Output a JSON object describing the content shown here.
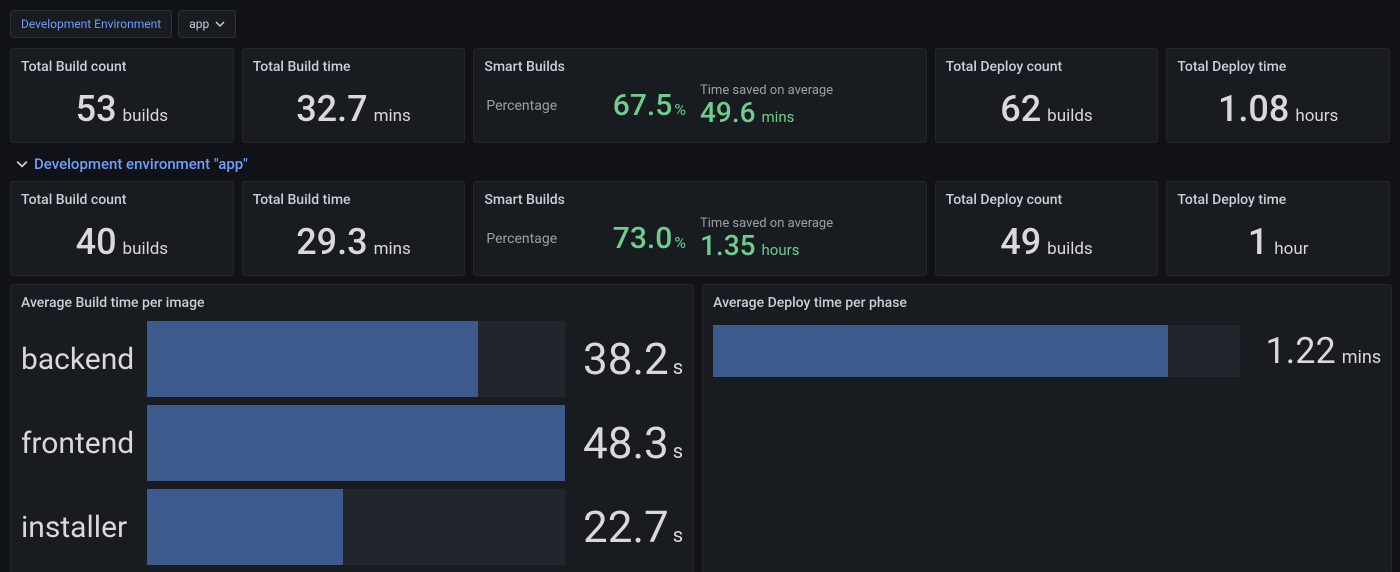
{
  "header": {
    "env_label": "Development Environment",
    "dropdown_value": "app"
  },
  "row1": {
    "build_count": {
      "title": "Total Build count",
      "value": "53",
      "unit": "builds"
    },
    "build_time": {
      "title": "Total Build time",
      "value": "32.7",
      "unit": "mins"
    },
    "smart": {
      "title": "Smart Builds",
      "pct_label": "Percentage",
      "pct_value": "67.5",
      "pct_unit": "%",
      "saved_label": "Time saved on average",
      "saved_value": "49.6",
      "saved_unit": "mins"
    },
    "deploy_count": {
      "title": "Total Deploy count",
      "value": "62",
      "unit": "builds"
    },
    "deploy_time": {
      "title": "Total Deploy time",
      "value": "1.08",
      "unit": "hours"
    }
  },
  "section": {
    "title": "Development environment \"app\""
  },
  "row2": {
    "build_count": {
      "title": "Total Build count",
      "value": "40",
      "unit": "builds"
    },
    "build_time": {
      "title": "Total Build time",
      "value": "29.3",
      "unit": "mins"
    },
    "smart": {
      "title": "Smart Builds",
      "pct_label": "Percentage",
      "pct_value": "73.0",
      "pct_unit": "%",
      "saved_label": "Time saved on average",
      "saved_value": "1.35",
      "saved_unit": "hours"
    },
    "deploy_count": {
      "title": "Total Deploy count",
      "value": "49",
      "unit": "builds"
    },
    "deploy_time": {
      "title": "Total Deploy time",
      "value": "1",
      "unit": "hour"
    }
  },
  "charts": {
    "left": {
      "title": "Average Build time per image"
    },
    "right": {
      "title": "Average Deploy time per phase"
    }
  },
  "chart_data": [
    {
      "type": "bar",
      "title": "Average Build time per image",
      "xlabel": "",
      "ylabel": "",
      "categories": [
        "backend",
        "frontend",
        "installer"
      ],
      "values": [
        38.2,
        48.3,
        22.7
      ],
      "unit": "s",
      "max": 48.3
    },
    {
      "type": "bar",
      "title": "Average Deploy time per phase",
      "xlabel": "",
      "ylabel": "",
      "categories": [
        ""
      ],
      "values": [
        1.22
      ],
      "unit": "mins",
      "fill_ratio": 0.865
    }
  ]
}
